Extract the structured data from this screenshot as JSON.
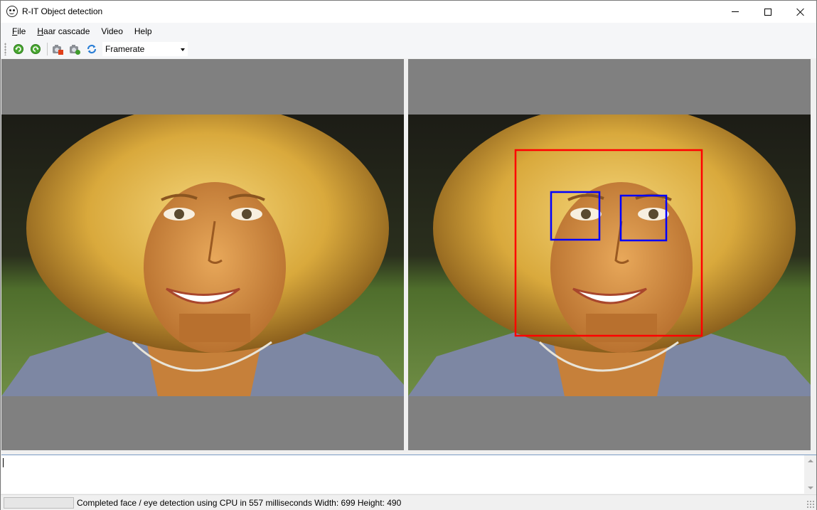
{
  "window": {
    "title": "R-IT Object detection",
    "icon": "smiley-icon"
  },
  "menu": {
    "items": [
      {
        "label": "File",
        "accel": "F",
        "rest": "ile"
      },
      {
        "label": "Haar cascade",
        "accel": "H",
        "rest": "aar cascade"
      },
      {
        "label": "Video",
        "accel": "",
        "rest": "Video"
      },
      {
        "label": "Help",
        "accel": "",
        "rest": "Help"
      }
    ]
  },
  "toolbar": {
    "buttons": [
      {
        "name": "rotate-left-icon",
        "color": "#3f9b2b"
      },
      {
        "name": "rotate-right-icon",
        "color": "#3f9b2b"
      },
      {
        "name": "camera-stop-icon",
        "color": "#e0401a"
      },
      {
        "name": "camera-icon",
        "color": "#3f9b2b"
      },
      {
        "name": "refresh-icon",
        "color": "#2b7fd6"
      }
    ],
    "framerate": {
      "value": "Framerate"
    }
  },
  "detection": {
    "face_box_color": "#ff0000",
    "eye_box_color": "#0000ff"
  },
  "log": {
    "text": ""
  },
  "status": {
    "progress": 0,
    "message": "Completed face / eye detection using CPU in 557 milliseconds  Width: 699  Height: 490"
  }
}
